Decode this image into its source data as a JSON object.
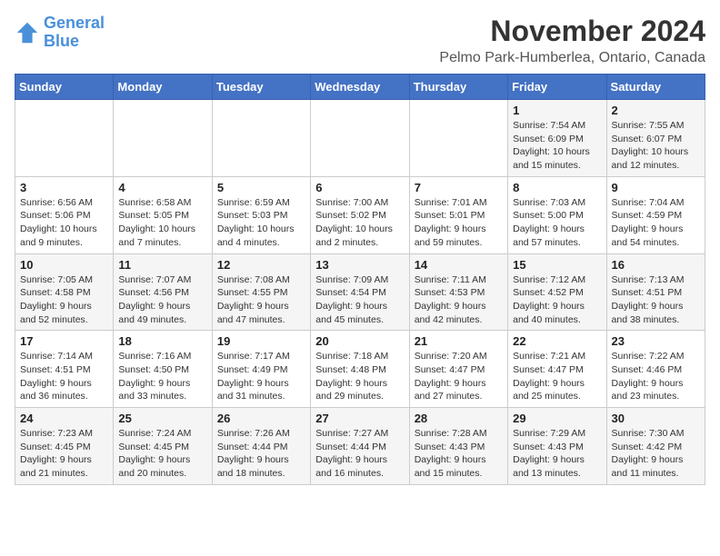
{
  "logo": {
    "line1": "General",
    "line2": "Blue"
  },
  "title": "November 2024",
  "subtitle": "Pelmo Park-Humberlea, Ontario, Canada",
  "days_of_week": [
    "Sunday",
    "Monday",
    "Tuesday",
    "Wednesday",
    "Thursday",
    "Friday",
    "Saturday"
  ],
  "weeks": [
    [
      {
        "day": "",
        "info": ""
      },
      {
        "day": "",
        "info": ""
      },
      {
        "day": "",
        "info": ""
      },
      {
        "day": "",
        "info": ""
      },
      {
        "day": "",
        "info": ""
      },
      {
        "day": "1",
        "info": "Sunrise: 7:54 AM\nSunset: 6:09 PM\nDaylight: 10 hours and 15 minutes."
      },
      {
        "day": "2",
        "info": "Sunrise: 7:55 AM\nSunset: 6:07 PM\nDaylight: 10 hours and 12 minutes."
      }
    ],
    [
      {
        "day": "3",
        "info": "Sunrise: 6:56 AM\nSunset: 5:06 PM\nDaylight: 10 hours and 9 minutes."
      },
      {
        "day": "4",
        "info": "Sunrise: 6:58 AM\nSunset: 5:05 PM\nDaylight: 10 hours and 7 minutes."
      },
      {
        "day": "5",
        "info": "Sunrise: 6:59 AM\nSunset: 5:03 PM\nDaylight: 10 hours and 4 minutes."
      },
      {
        "day": "6",
        "info": "Sunrise: 7:00 AM\nSunset: 5:02 PM\nDaylight: 10 hours and 2 minutes."
      },
      {
        "day": "7",
        "info": "Sunrise: 7:01 AM\nSunset: 5:01 PM\nDaylight: 9 hours and 59 minutes."
      },
      {
        "day": "8",
        "info": "Sunrise: 7:03 AM\nSunset: 5:00 PM\nDaylight: 9 hours and 57 minutes."
      },
      {
        "day": "9",
        "info": "Sunrise: 7:04 AM\nSunset: 4:59 PM\nDaylight: 9 hours and 54 minutes."
      }
    ],
    [
      {
        "day": "10",
        "info": "Sunrise: 7:05 AM\nSunset: 4:58 PM\nDaylight: 9 hours and 52 minutes."
      },
      {
        "day": "11",
        "info": "Sunrise: 7:07 AM\nSunset: 4:56 PM\nDaylight: 9 hours and 49 minutes."
      },
      {
        "day": "12",
        "info": "Sunrise: 7:08 AM\nSunset: 4:55 PM\nDaylight: 9 hours and 47 minutes."
      },
      {
        "day": "13",
        "info": "Sunrise: 7:09 AM\nSunset: 4:54 PM\nDaylight: 9 hours and 45 minutes."
      },
      {
        "day": "14",
        "info": "Sunrise: 7:11 AM\nSunset: 4:53 PM\nDaylight: 9 hours and 42 minutes."
      },
      {
        "day": "15",
        "info": "Sunrise: 7:12 AM\nSunset: 4:52 PM\nDaylight: 9 hours and 40 minutes."
      },
      {
        "day": "16",
        "info": "Sunrise: 7:13 AM\nSunset: 4:51 PM\nDaylight: 9 hours and 38 minutes."
      }
    ],
    [
      {
        "day": "17",
        "info": "Sunrise: 7:14 AM\nSunset: 4:51 PM\nDaylight: 9 hours and 36 minutes."
      },
      {
        "day": "18",
        "info": "Sunrise: 7:16 AM\nSunset: 4:50 PM\nDaylight: 9 hours and 33 minutes."
      },
      {
        "day": "19",
        "info": "Sunrise: 7:17 AM\nSunset: 4:49 PM\nDaylight: 9 hours and 31 minutes."
      },
      {
        "day": "20",
        "info": "Sunrise: 7:18 AM\nSunset: 4:48 PM\nDaylight: 9 hours and 29 minutes."
      },
      {
        "day": "21",
        "info": "Sunrise: 7:20 AM\nSunset: 4:47 PM\nDaylight: 9 hours and 27 minutes."
      },
      {
        "day": "22",
        "info": "Sunrise: 7:21 AM\nSunset: 4:47 PM\nDaylight: 9 hours and 25 minutes."
      },
      {
        "day": "23",
        "info": "Sunrise: 7:22 AM\nSunset: 4:46 PM\nDaylight: 9 hours and 23 minutes."
      }
    ],
    [
      {
        "day": "24",
        "info": "Sunrise: 7:23 AM\nSunset: 4:45 PM\nDaylight: 9 hours and 21 minutes."
      },
      {
        "day": "25",
        "info": "Sunrise: 7:24 AM\nSunset: 4:45 PM\nDaylight: 9 hours and 20 minutes."
      },
      {
        "day": "26",
        "info": "Sunrise: 7:26 AM\nSunset: 4:44 PM\nDaylight: 9 hours and 18 minutes."
      },
      {
        "day": "27",
        "info": "Sunrise: 7:27 AM\nSunset: 4:44 PM\nDaylight: 9 hours and 16 minutes."
      },
      {
        "day": "28",
        "info": "Sunrise: 7:28 AM\nSunset: 4:43 PM\nDaylight: 9 hours and 15 minutes."
      },
      {
        "day": "29",
        "info": "Sunrise: 7:29 AM\nSunset: 4:43 PM\nDaylight: 9 hours and 13 minutes."
      },
      {
        "day": "30",
        "info": "Sunrise: 7:30 AM\nSunset: 4:42 PM\nDaylight: 9 hours and 11 minutes."
      }
    ]
  ]
}
